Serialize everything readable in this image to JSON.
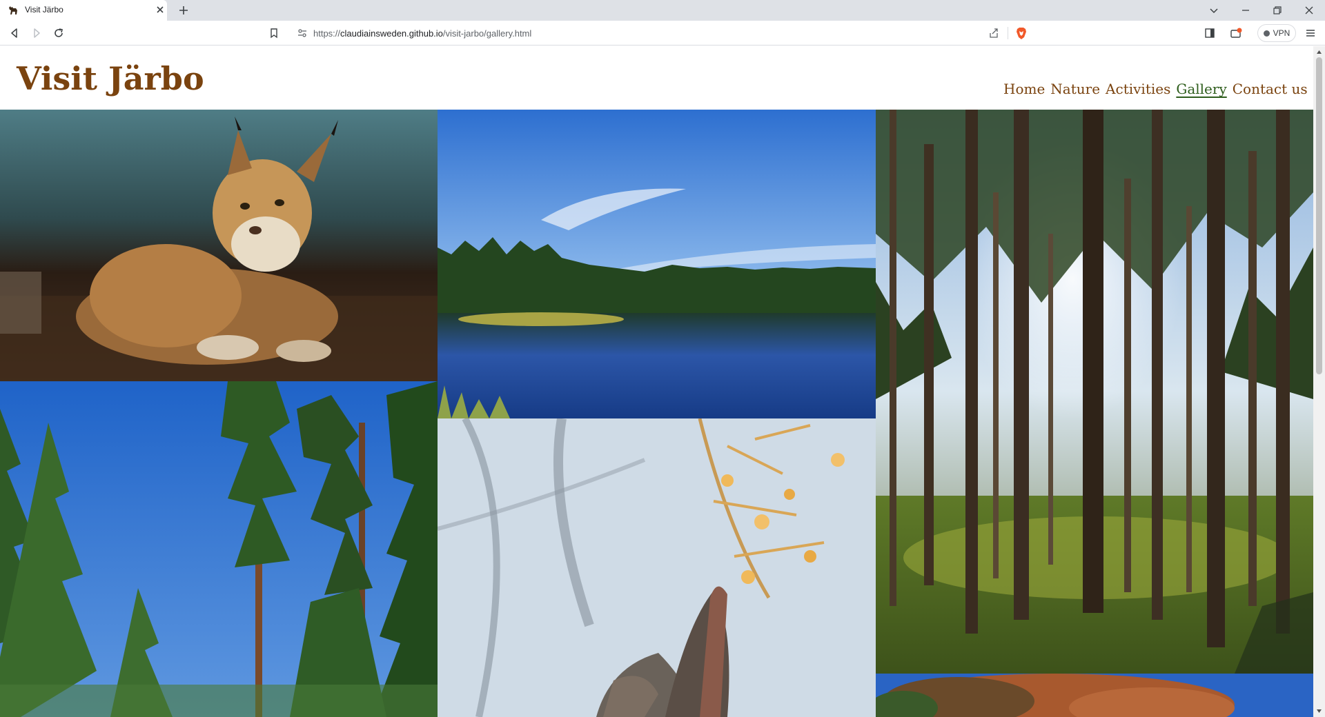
{
  "browser": {
    "tab_title": "Visit Järbo",
    "url_host": "claudiainsweden.github.io",
    "url_path": "/visit-jarbo/gallery.html",
    "url_scheme": "https://",
    "vpn_label": "VPN"
  },
  "site": {
    "title": "Visit Järbo",
    "nav": [
      {
        "label": "Home",
        "active": false
      },
      {
        "label": "Nature",
        "active": false
      },
      {
        "label": "Activities",
        "active": false
      },
      {
        "label": "Gallery",
        "active": true
      },
      {
        "label": "Contact us",
        "active": false
      }
    ]
  },
  "gallery": {
    "photos": [
      {
        "name": "lynx-photo",
        "subject": "lynx lying on forest floor"
      },
      {
        "name": "lake-photo",
        "subject": "forest lake under blue sky"
      },
      {
        "name": "pine-forest-photo",
        "subject": "tall pine trees with mossy ground"
      },
      {
        "name": "tall-pines-photo",
        "subject": "tall pine trees against blue sky"
      },
      {
        "name": "moose-photo",
        "subject": "moose ears among branches"
      },
      {
        "name": "autumn-tree-photo",
        "subject": "autumn tree under blue sky"
      }
    ]
  },
  "colors": {
    "brand": "#7a430f",
    "active_nav": "#2e5d1c"
  }
}
